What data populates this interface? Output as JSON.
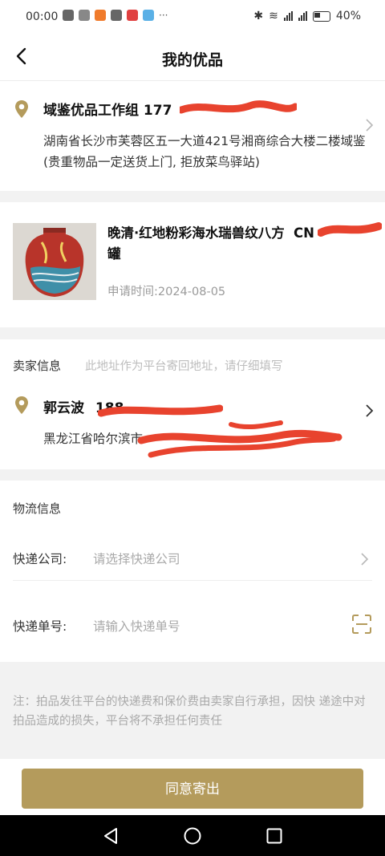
{
  "status_bar": {
    "time": "00:00",
    "battery": "40%"
  },
  "header": {
    "title": "我的优品"
  },
  "address": {
    "name": "域鉴优品工作组 177",
    "detail": "湖南省长沙市芙蓉区五一大道421号湘商综合大楼二楼域鉴 (贵重物品一定送货上门, 拒放菜鸟驿站)"
  },
  "item": {
    "name": "晚清·红地粉彩海水瑞兽纹八方罐",
    "code": "CN",
    "apply_time": "申请时间:2024-08-05"
  },
  "seller": {
    "label": "卖家信息",
    "hint": "此地址作为平台寄回地址，请仔细填写",
    "name": "郭云波",
    "phone": "188",
    "detail": "黑龙江省哈尔滨市"
  },
  "logistics": {
    "section_title": "物流信息",
    "company_label": "快递公司:",
    "company_placeholder": "请选择快递公司",
    "number_label": "快递单号:",
    "number_placeholder": "请输入快递单号"
  },
  "note": "注：拍品发往平台的快递费和保价费由卖家自行承担，因快 递途中对拍品造成的损失，平台将不承担任何责任",
  "actions": {
    "agree": "同意寄出"
  },
  "colors": {
    "accent": "#b49b5c",
    "redaction": "#e8432e"
  },
  "icons": [
    "back-icon",
    "location-pin-icon",
    "chevron-right-icon",
    "scan-icon",
    "nav-back-icon",
    "nav-home-icon",
    "nav-recents-icon"
  ]
}
